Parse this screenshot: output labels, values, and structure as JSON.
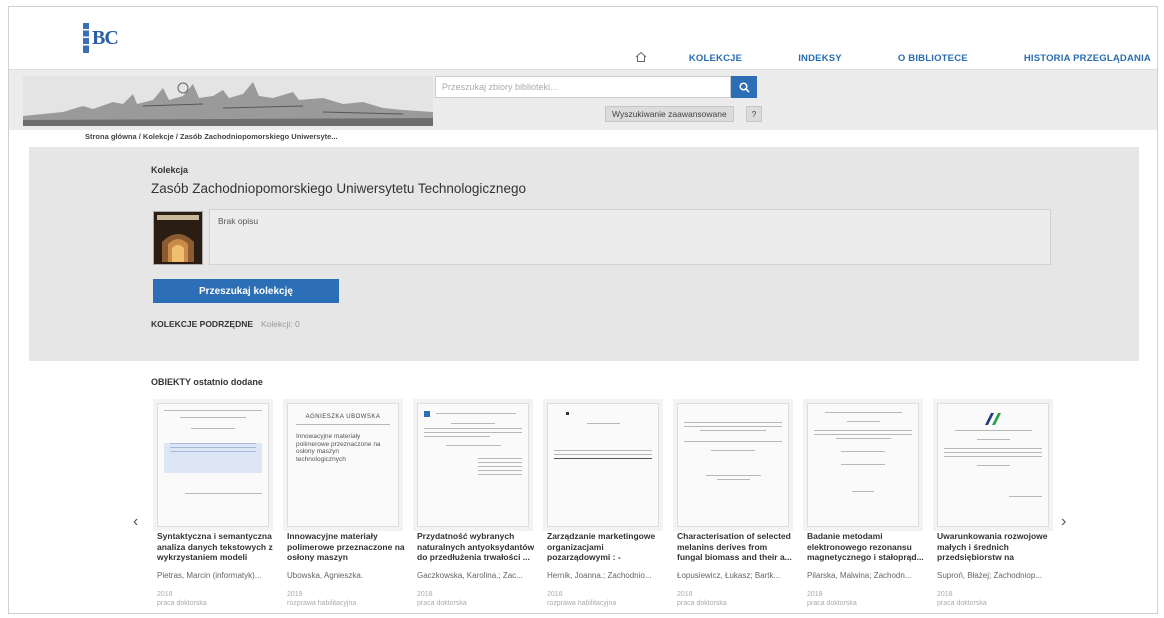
{
  "header": {
    "logo_text": "BC",
    "nav": {
      "home_icon": "home-icon",
      "items": [
        "KOLEKCJE",
        "INDEKSY",
        "O BIBLIOTECE",
        "HISTORIA PRZEGLĄDANIA"
      ]
    }
  },
  "search": {
    "placeholder": "Przeszukaj zbiory biblioteki...",
    "button_icon": "search-icon",
    "advanced_label": "Wyszukiwanie zaawansowane",
    "help_label": "?"
  },
  "breadcrumb": "Strona główna / Kolekcje / Zasób Zachodniopomorskiego Uniwersyte...",
  "collection": {
    "label": "Kolekcja",
    "title": "Zasób Zachodniopomorskiego Uniwersytetu Technologicznego",
    "description": "Brak opisu",
    "search_button": "Przeszukaj kolekcję",
    "subcollections_label": "KOLEKCJE PODRZĘDNE",
    "subcollections_count": "Kolekcji: 0"
  },
  "recent": {
    "title": "OBIEKTY ostatnio dodane",
    "prev_icon": "chevron-left-icon",
    "next_icon": "chevron-right-icon",
    "items": [
      {
        "title": "Syntaktyczna i semantyczna analiza danych tekstowych z wykrzystaniem modeli",
        "author": "Pietras, Marcin (informatyk)...",
        "year": "2018",
        "type": "praca doktorska"
      },
      {
        "title": "Innowacyjne materiały polimerowe przeznaczone na osłony maszyn",
        "author": "Ubowska, Agnieszka.",
        "year": "2019",
        "type": "rozprawa habilitacyjna",
        "cover_author": "AGNIESZKA UBOWSKA",
        "cover_title": "Innowacyjne materiały polimerowe przeznaczone na osłony maszyn technologicznych"
      },
      {
        "title": "Przydatność wybranych naturalnych antyoksydantów do przedłużenia trwałości ...",
        "author": "Gaczkowska, Karolina.; Zac...",
        "year": "2018",
        "type": "praca doktorska"
      },
      {
        "title": "Zarządzanie marketingowe organizacjami pozarządowymi : - uwarunk...",
        "author": "Hernik, Joanna.; Zachodnio...",
        "year": "2016",
        "type": "rozprawa habilitacyjna"
      },
      {
        "title": "Characterisation of selected melanins derives from fungal biomass and their a...",
        "author": "Łopusiewicz, Łukasz; Bartk...",
        "year": "2018",
        "type": "praca doktorska"
      },
      {
        "title": "Badanie metodami elektronowego rezonansu magnetycznego i stałoprąd...",
        "author": "Pilarska, Malwina; Zachodn...",
        "year": "2018",
        "type": "praca doktorska"
      },
      {
        "title": "Uwarunkowania rozwojowe małych i średnich przedsiębiorstw na",
        "author": "Suproń, Błażej; Zachodniop...",
        "year": "2018",
        "type": "praca doktorska"
      }
    ]
  },
  "colors": {
    "accent": "#2d6fb7",
    "nav_text": "#2a6cb0",
    "panel_bg": "#e6e6e6"
  }
}
